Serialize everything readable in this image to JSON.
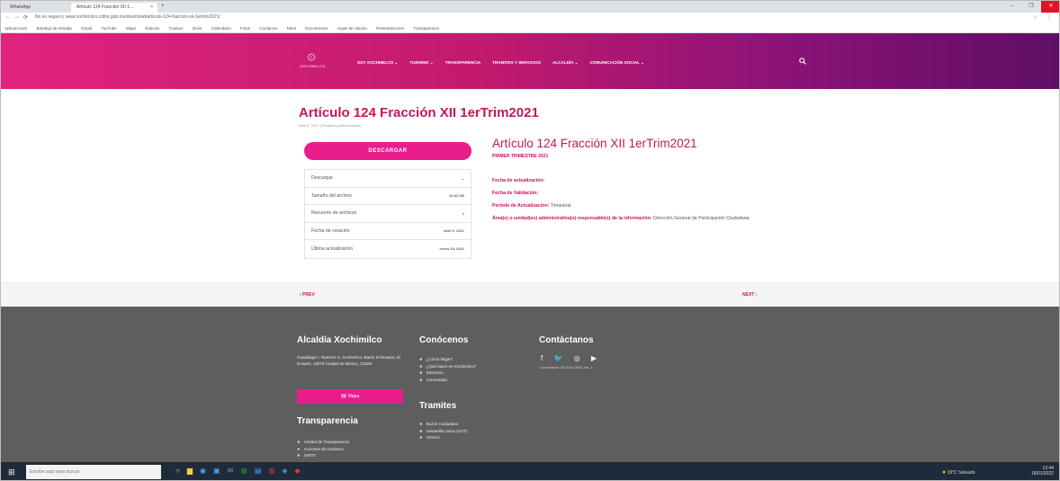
{
  "browser": {
    "tabs": [
      "WhatsApp",
      "Artículo 124 Fracción XII 1..."
    ],
    "tab_close": "×",
    "new_tab": "+",
    "window_controls": [
      "‒",
      "❐",
      "✕"
    ],
    "nav": [
      "←",
      "→",
      "⟳"
    ],
    "url": "No es seguro | www.xochimilco.cdmx.gob.mx/download/articulo-124-fraccion-xii-1ertrim2021/",
    "address_icons": "☆ ⋮",
    "bookmarks": [
      "Aplicaciones",
      "Bandeja de entrada",
      "Gmail",
      "YouTube",
      "Maps",
      "Noticias",
      "Traducir",
      "Drive",
      "Calendario",
      "Fotos",
      "Contactos",
      "Meet",
      "Documentos",
      "Hojas de cálculo",
      "Presentaciones",
      "Transparencia"
    ]
  },
  "site": {
    "logo_mark": "۞",
    "logo_text": "XOCHIMILCO",
    "nav": [
      "SOY XOCHIMILCO ⌄",
      "TURISMO ⌄",
      "TRANSPARENCIA",
      "TRAMITES Y SERVICIOS",
      "ALCALDÍA ⌄",
      "COMUNICACIÓN SOCIAL ⌄"
    ],
    "search_icon": "search-icon"
  },
  "article": {
    "title": "Artículo 124 Fracción XII 1erTrim2021",
    "meta": "Abril 5, 2021  |  Posted by Administrador",
    "download_button": "DESCARGAR",
    "info": [
      {
        "label": "Descargar",
        "value": "⌄"
      },
      {
        "label": "Tamaño del archivo",
        "value": "42.82 KB"
      },
      {
        "label": "Recuento de archivos",
        "value": "1"
      },
      {
        "label": "Fecha de creación",
        "value": "abril 5, 2021"
      },
      {
        "label": "Última actualización",
        "value": "enero 18, 2022"
      }
    ],
    "doc_title": "Artículo 124 Fracción XII 1erTrim2021",
    "doc_subtitle": "PRIMER TRIMESTRE 2021",
    "fields": [
      {
        "label": "Fecha de actualización:",
        "value": ""
      },
      {
        "label": "Fecha de Validación:",
        "value": ""
      },
      {
        "label": "Periodo de Actualización:",
        "value": "Trimestral."
      },
      {
        "label": "Área(s) o unidad(es) administrativa(s) responsable(s) de la información:",
        "value": "Dirección General de Participación Ciudadana."
      }
    ],
    "prev": "‹  PREV",
    "next": "NEXT  ›"
  },
  "footer": {
    "col1_title": "Alcaldía Xochimilco",
    "address": "Guadalupe I. Ramírez 4, Xochimilco, Barrio El Rosario, El Rosario, 16070 Ciudad de México, CDMX",
    "button": "🗺 Mapa",
    "col1b_title": "Transparencia",
    "transparencia_links": [
      "Unidad de Transparencia",
      "Acciones de Gobierno",
      "SIPOT"
    ],
    "col2_title": "Conócenos",
    "conocenos_links": [
      "¿Cómo llegar?",
      "¿Qué hacer en Xochimilco?",
      "Directorio",
      "Comunidad"
    ],
    "col2b_title": "Tramites",
    "tramites_links": [
      "Buzón Ciudadano",
      "Ventanilla Única (VUT)",
      "CESAC"
    ],
    "col3_title": "Contáctanos",
    "social": "f  🐦  ◎  ▶",
    "social_sub": "Conmutador: 55 5334 0600 ext. 1"
  },
  "taskbar": {
    "start": "⊞",
    "search_placeholder": "Escribe aquí para buscar",
    "weather": "19°C Soleado",
    "time": "13:44",
    "date": "18/01/2022"
  }
}
